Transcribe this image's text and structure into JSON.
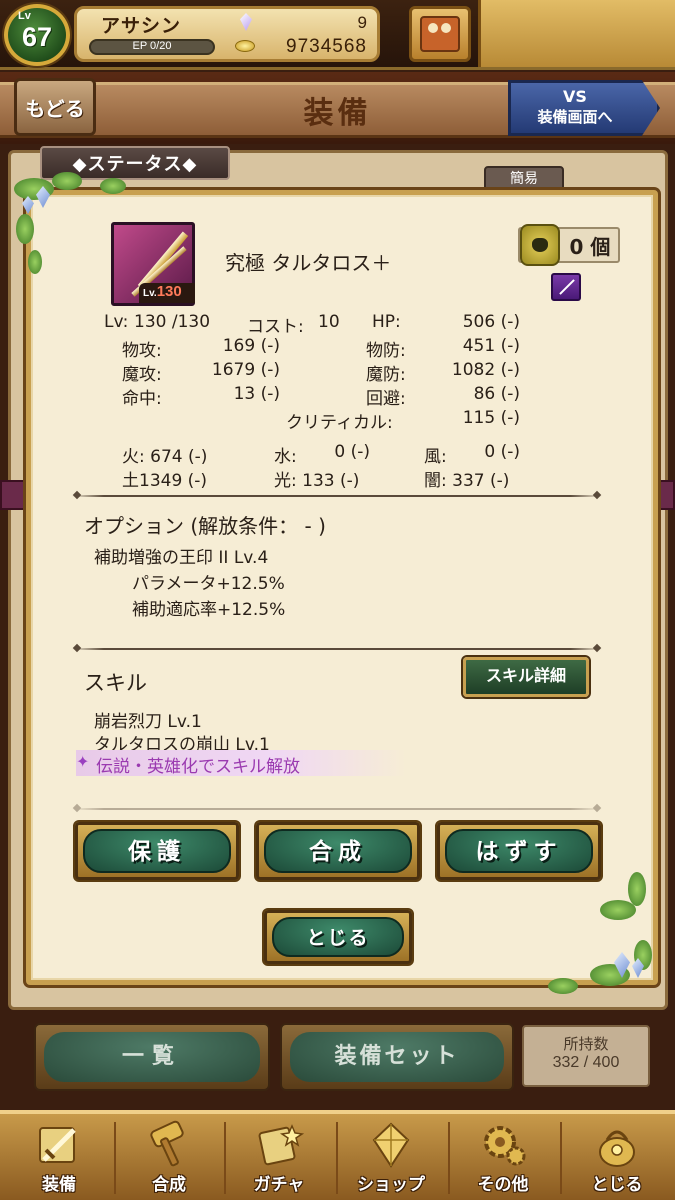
{
  "player": {
    "level_label": "Lv",
    "level": "67",
    "name": "アサシン",
    "ep": "EP 0/20",
    "gems": "9",
    "gold": "9734568"
  },
  "header": {
    "back_label": "もどる",
    "title": "装備",
    "vs_line1": "VS",
    "vs_line2": "装備画面へ"
  },
  "background": {
    "status_tab": "◆ステータス◆",
    "simple_label": "簡易"
  },
  "item": {
    "level_prefix": "Lv.",
    "level": "130",
    "name": "究極 タルタロス＋",
    "count": "0 個"
  },
  "stats": {
    "lv_label": "Lv:",
    "lv_value": "130 /130",
    "cost_label": "コスト:",
    "cost_value": "10",
    "hp_label": "HP:",
    "hp_value": "506 (-)",
    "patk_label": "物攻:",
    "patk_value": "169 (-)",
    "pdef_label": "物防:",
    "pdef_value": "451 (-)",
    "matk_label": "魔攻:",
    "matk_value": "1679 (-)",
    "mdef_label": "魔防:",
    "mdef_value": "1082 (-)",
    "hit_label": "命中:",
    "hit_value": "13 (-)",
    "eva_label": "回避:",
    "eva_value": "86 (-)",
    "crit_label": "クリティカル:",
    "crit_value": "115 (-)"
  },
  "elements": {
    "fire": "火: 674 (-)",
    "water_label": "水:",
    "water_value": "0 (-)",
    "wind_label": "風:",
    "wind_value": "0 (-)",
    "earth": "土1349 (-)",
    "light": "光: 133 (-)",
    "dark": "闇: 337 (-)"
  },
  "options": {
    "title": "オプション (解放条件： - )",
    "name": "補助増強の王印 II  Lv.4",
    "line1": "パラメータ+12.5%",
    "line2": "補助適応率+12.5%"
  },
  "skills": {
    "title": "スキル",
    "detail_button": "スキル詳細",
    "items": [
      "崩岩烈刀  Lv.1",
      "タルタロスの崩山  Lv.1"
    ],
    "locked": "伝説・英雄化でスキル解放"
  },
  "actions": {
    "protect": "保護",
    "synth": "合成",
    "remove": "はずす",
    "close": "とじる"
  },
  "bottom": {
    "list": "一覧",
    "equip_set": "装備セット",
    "hold_label": "所持数",
    "hold_value": "332 / 400"
  },
  "nav": [
    {
      "label": "装備",
      "icon": "sword-icon"
    },
    {
      "label": "合成",
      "icon": "hammer-icon"
    },
    {
      "label": "ガチャ",
      "icon": "gacha-icon"
    },
    {
      "label": "ショップ",
      "icon": "crystal-icon"
    },
    {
      "label": "その他",
      "icon": "gear-icon"
    },
    {
      "label": "とじる",
      "icon": "bag-icon"
    }
  ]
}
